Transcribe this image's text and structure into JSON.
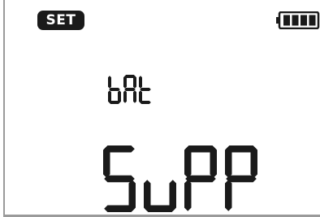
{
  "header": {
    "set_label": "SET"
  },
  "battery": {
    "icon": "battery-full-icon",
    "level": 1.0
  },
  "display": {
    "line1": "bAt",
    "line2": "SuPP"
  },
  "colors": {
    "segment": "#1a1a1a",
    "badge_bg": "#1a1a1a",
    "badge_text": "#ffffff",
    "frame": "#9a9a9a",
    "background": "#ffffff"
  }
}
